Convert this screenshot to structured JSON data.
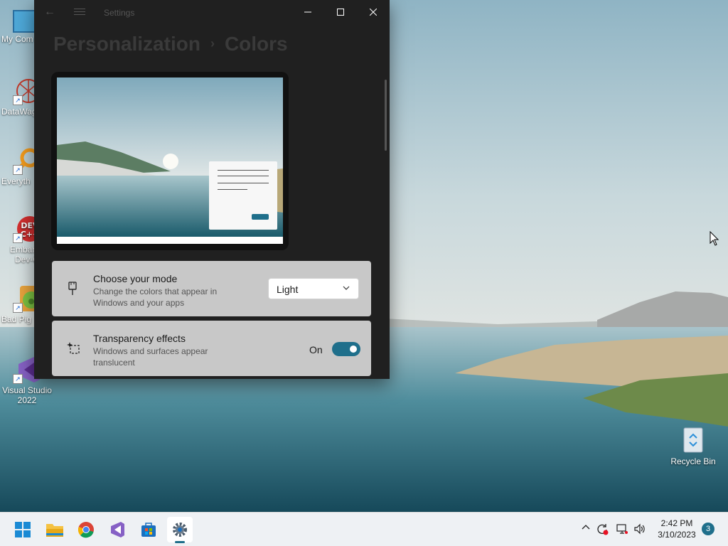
{
  "desktop": {
    "icons": [
      {
        "label": "My Com"
      },
      {
        "label": "DataWag"
      },
      {
        "label": "Everyth"
      },
      {
        "label": "Embarca Dev-C"
      },
      {
        "label": "Bad Pig"
      },
      {
        "label": "Visual Studio 2022"
      }
    ],
    "recycle_bin": "Recycle Bin"
  },
  "window": {
    "title": "Settings",
    "breadcrumb": {
      "parent": "Personalization",
      "separator": "›",
      "current": "Colors"
    }
  },
  "cards": {
    "mode": {
      "title": "Choose your mode",
      "description": "Change the colors that appear in Windows and your apps",
      "selected": "Light"
    },
    "transparency": {
      "title": "Transparency effects",
      "description": "Windows and surfaces appear translucent",
      "state_label": "On",
      "enabled": true
    }
  },
  "taskbar": {
    "time": "2:42 PM",
    "date": "3/10/2023",
    "notification_count": "3"
  },
  "colors": {
    "accent": "#1f6f8b",
    "window_bg": "#202020",
    "card_bg": "#c8c8c8"
  }
}
